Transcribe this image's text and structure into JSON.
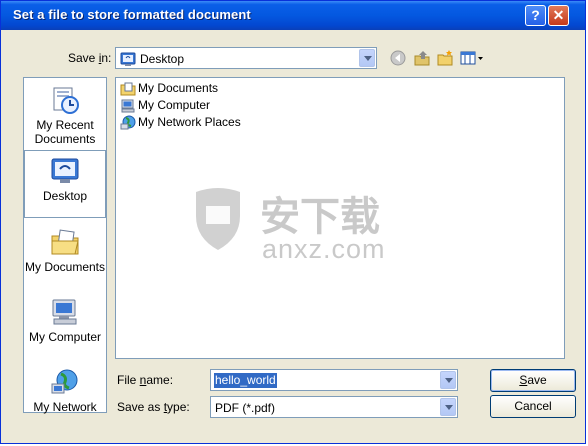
{
  "window": {
    "title": "Set a file to store formatted document",
    "help_label": "?",
    "close_label": "✕"
  },
  "savein": {
    "label_prefix": "Save ",
    "label_accel": "i",
    "label_suffix": "n:",
    "value": "Desktop"
  },
  "places": [
    {
      "label": "My Recent Documents",
      "icon": "recent-documents-icon"
    },
    {
      "label": "Desktop",
      "icon": "desktop-icon"
    },
    {
      "label": "My Documents",
      "icon": "my-documents-icon"
    },
    {
      "label": "My Computer",
      "icon": "my-computer-icon"
    },
    {
      "label": "My Network",
      "icon": "my-network-icon"
    }
  ],
  "files": [
    {
      "name": "My Documents",
      "icon": "folder-documents-icon"
    },
    {
      "name": "My Computer",
      "icon": "computer-icon"
    },
    {
      "name": "My Network Places",
      "icon": "network-icon"
    }
  ],
  "filename": {
    "label_prefix": "File ",
    "label_accel": "n",
    "label_suffix": "ame:",
    "value": "hello_world"
  },
  "filetype": {
    "label_prefix": "Save as ",
    "label_accel": "t",
    "label_suffix": "ype:",
    "value": "PDF (*.pdf)"
  },
  "buttons": {
    "save_accel": "S",
    "save_rest": "ave",
    "cancel_label": "Cancel"
  },
  "watermark": {
    "chars": "安下载",
    "domain": "anxz.com"
  },
  "colors": {
    "titlebar": "#0458e0",
    "dialog_bg": "#ece9d8",
    "border": "#7f9db9",
    "selection": "#316ac5"
  }
}
